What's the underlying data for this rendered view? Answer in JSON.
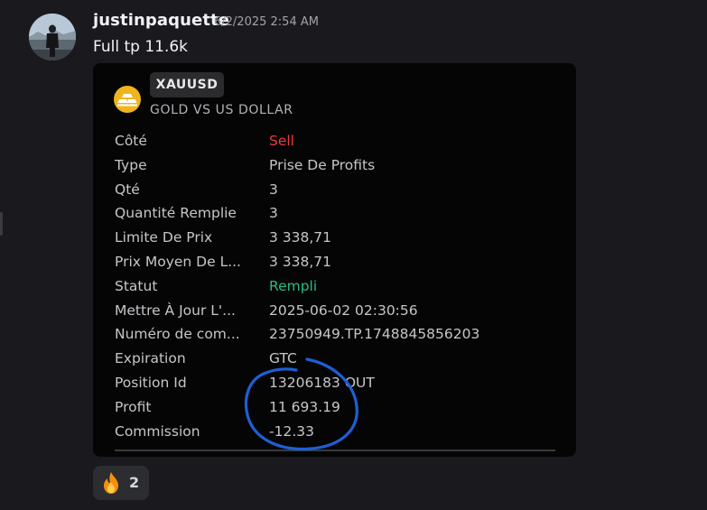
{
  "message": {
    "username": "justinpaquette",
    "timestamp": "6/2/2025 2:54 AM",
    "text": "Full tp 11.6k"
  },
  "embed": {
    "symbol": "XAUUSD",
    "symbol_name": "GOLD VS US DOLLAR",
    "icon": "gold-bars-icon",
    "rows": [
      {
        "label": "Côté",
        "value": "Sell"
      },
      {
        "label": "Type",
        "value": "Prise De Profits"
      },
      {
        "label": "Qté",
        "value": "3"
      },
      {
        "label": "Quantité Remplie",
        "value": "3"
      },
      {
        "label": "Limite De Prix",
        "value": "3 338,71"
      },
      {
        "label": "Prix Moyen De L...",
        "value": "3 338,71"
      },
      {
        "label": "Statut",
        "value": "Rempli"
      },
      {
        "label": "Mettre À Jour L'...",
        "value": "2025-06-02 02:30:56"
      },
      {
        "label": "Numéro de com...",
        "value": "23750949.TP.1748845856203"
      },
      {
        "label": "Expiration",
        "value": "GTC"
      },
      {
        "label": "Position Id",
        "value": "13206183 OUT"
      },
      {
        "label": "Profit",
        "value": "11 693.19"
      },
      {
        "label": "Commission",
        "value": "-12.33"
      }
    ]
  },
  "reaction": {
    "emoji": "fire-icon",
    "count": "2"
  },
  "colors": {
    "background": "#1a1a1e",
    "embed_background": "#050505",
    "sell": "#ee3b3b",
    "filled": "#26b98c",
    "annotation": "#1e5fd6",
    "gold": "#f0b41c"
  }
}
